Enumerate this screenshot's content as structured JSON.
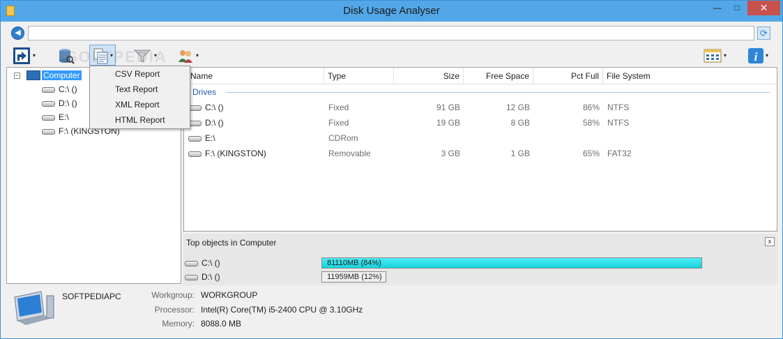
{
  "window": {
    "title": "Disk Usage Analyser",
    "min_glyph": "—",
    "max_glyph": "□",
    "close_glyph": "✕"
  },
  "address": {
    "value": "",
    "back_glyph": "◀",
    "refresh_glyph": "⟳"
  },
  "toolbar": {
    "items": [
      {
        "icon": "open-folder-icon"
      },
      {
        "icon": "database-scan-icon"
      },
      {
        "icon": "report-icon"
      },
      {
        "icon": "filter-funnel-icon"
      },
      {
        "icon": "users-icon"
      },
      {
        "icon": "view-layout-icon"
      },
      {
        "icon": "info-icon"
      }
    ],
    "arrow": "▾"
  },
  "report_menu": {
    "items": [
      {
        "label": "CSV Report"
      },
      {
        "label": "Text Report"
      },
      {
        "label": "XML Report"
      },
      {
        "label": "HTML Report"
      }
    ]
  },
  "tree": {
    "expander": "−",
    "root": "Computer",
    "children": [
      "C:\\ ()",
      "D:\\ ()",
      "E:\\",
      "F:\\ (KINGSTON)"
    ]
  },
  "list": {
    "columns": [
      "Name",
      "Type",
      "Size",
      "Free Space",
      "Pct Full",
      "File System"
    ],
    "group": "Drives",
    "rows": [
      {
        "name": "C:\\ ()",
        "type": "Fixed",
        "size": "91 GB",
        "free": "12 GB",
        "pct": "86%",
        "fs": "NTFS"
      },
      {
        "name": "D:\\ ()",
        "type": "Fixed",
        "size": "19 GB",
        "free": "8 GB",
        "pct": "58%",
        "fs": "NTFS"
      },
      {
        "name": "E:\\",
        "type": "CDRom",
        "size": "",
        "free": "",
        "pct": "",
        "fs": ""
      },
      {
        "name": "F:\\ (KINGSTON)",
        "type": "Removable",
        "size": "3 GB",
        "free": "1 GB",
        "pct": "65%",
        "fs": "FAT32"
      }
    ]
  },
  "top_objects": {
    "title": "Top objects in Computer",
    "close_glyph": "x",
    "items": [
      {
        "name": "C:\\ ()",
        "bar_text": "81110MB (84%)",
        "fill_fraction": 1.0
      },
      {
        "name": "D:\\ ()",
        "bar_text": "11959MB (12%)",
        "fill_fraction": 0.0
      }
    ]
  },
  "info": {
    "computer_name": "SOFTPEDIAPC",
    "workgroup_label": "Workgroup:",
    "workgroup": "WORKGROUP",
    "processor_label": "Processor:",
    "processor": "Intel(R) Core(TM) i5-2400 CPU @ 3.10GHz",
    "memory_label": "Memory:",
    "memory": "8088.0 MB"
  },
  "watermark": "SOFTPEDIA",
  "colors": {
    "titlebar": "#53a7e8",
    "close": "#c7514d",
    "selection": "#3399ff",
    "bar": "#20dbe6"
  }
}
